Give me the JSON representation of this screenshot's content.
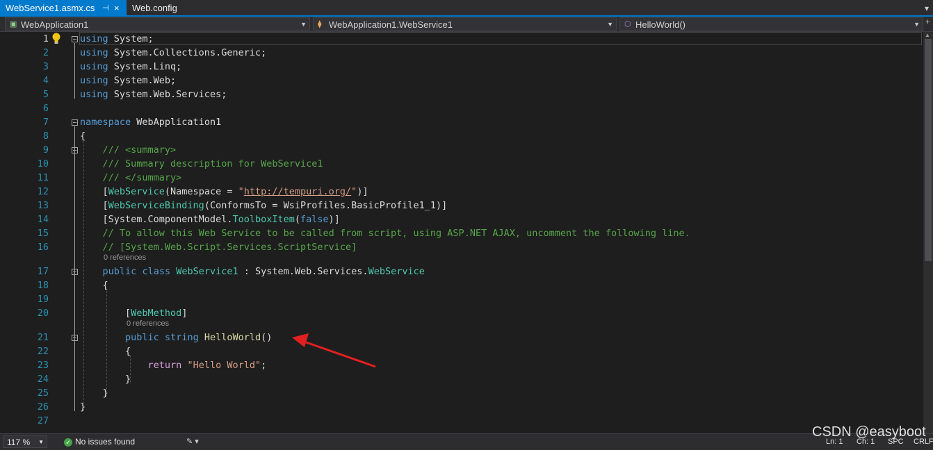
{
  "tabs": [
    {
      "label": "WebService1.asmx.cs",
      "active": true,
      "pin": "⊣",
      "close": "×"
    },
    {
      "label": "Web.config",
      "active": false
    }
  ],
  "tab_overflow": "▾",
  "nav": {
    "project": "WebApplication1",
    "class": "WebApplication1.WebService1",
    "member": "HelloWorld()"
  },
  "code": {
    "lines": [
      {
        "n": "1",
        "segs": [
          [
            "kw",
            "using"
          ],
          [
            "p",
            " System;"
          ]
        ]
      },
      {
        "n": "2",
        "segs": [
          [
            "kw",
            "using"
          ],
          [
            "p",
            " System.Collections.Generic;"
          ]
        ]
      },
      {
        "n": "3",
        "segs": [
          [
            "kw",
            "using"
          ],
          [
            "p",
            " System.Linq;"
          ]
        ]
      },
      {
        "n": "4",
        "segs": [
          [
            "kw",
            "using"
          ],
          [
            "p",
            " System.Web;"
          ]
        ]
      },
      {
        "n": "5",
        "segs": [
          [
            "kw",
            "using"
          ],
          [
            "p",
            " System.Web.Services;"
          ]
        ]
      },
      {
        "n": "6",
        "segs": []
      },
      {
        "n": "7",
        "segs": [
          [
            "kw",
            "namespace"
          ],
          [
            "p",
            " WebApplication1"
          ]
        ]
      },
      {
        "n": "8",
        "segs": [
          [
            "p",
            "{"
          ]
        ]
      },
      {
        "n": "9",
        "segs": [
          [
            "p",
            "    "
          ],
          [
            "cm",
            "/// <summary>"
          ]
        ]
      },
      {
        "n": "10",
        "segs": [
          [
            "p",
            "    "
          ],
          [
            "cm",
            "/// Summary description for WebService1"
          ]
        ]
      },
      {
        "n": "11",
        "segs": [
          [
            "p",
            "    "
          ],
          [
            "cm",
            "/// </summary>"
          ]
        ]
      },
      {
        "n": "12",
        "segs": [
          [
            "p",
            "    ["
          ],
          [
            "ty",
            "WebService"
          ],
          [
            "p",
            "(Namespace = "
          ],
          [
            "st",
            "\""
          ],
          [
            "ln2",
            "http://tempuri.org/"
          ],
          [
            "st",
            "\""
          ],
          [
            "p",
            ")]"
          ]
        ]
      },
      {
        "n": "13",
        "segs": [
          [
            "p",
            "    ["
          ],
          [
            "ty",
            "WebServiceBinding"
          ],
          [
            "p",
            "(ConformsTo = WsiProfiles.BasicProfile1_1)]"
          ]
        ]
      },
      {
        "n": "14",
        "segs": [
          [
            "p",
            "    [System.ComponentModel."
          ],
          [
            "ty",
            "ToolboxItem"
          ],
          [
            "p",
            "("
          ],
          [
            "kw",
            "false"
          ],
          [
            "p",
            ")]"
          ]
        ]
      },
      {
        "n": "15",
        "segs": [
          [
            "p",
            "    "
          ],
          [
            "cm",
            "// To allow this Web Service to be called from script, using ASP.NET AJAX, uncomment the following line."
          ]
        ]
      },
      {
        "n": "16",
        "segs": [
          [
            "p",
            "    "
          ],
          [
            "cm",
            "// [System.Web.Script.Services.ScriptService]"
          ]
        ]
      },
      {
        "n": "17",
        "segs": [
          [
            "p",
            "    "
          ],
          [
            "kw",
            "public"
          ],
          [
            "p",
            " "
          ],
          [
            "kw",
            "class"
          ],
          [
            "p",
            " "
          ],
          [
            "ty",
            "WebService1"
          ],
          [
            "p",
            " : System.Web.Services."
          ],
          [
            "ty",
            "WebService"
          ]
        ]
      },
      {
        "n": "18",
        "segs": [
          [
            "p",
            "    {"
          ]
        ]
      },
      {
        "n": "19",
        "segs": []
      },
      {
        "n": "20",
        "segs": [
          [
            "p",
            "        ["
          ],
          [
            "ty",
            "WebMethod"
          ],
          [
            "p",
            "]"
          ]
        ]
      },
      {
        "n": "21",
        "segs": [
          [
            "p",
            "        "
          ],
          [
            "kw",
            "public"
          ],
          [
            "p",
            " "
          ],
          [
            "kw",
            "string"
          ],
          [
            "p",
            " "
          ],
          [
            "mt",
            "HelloWorld"
          ],
          [
            "p",
            "()"
          ]
        ]
      },
      {
        "n": "22",
        "segs": [
          [
            "p",
            "        {"
          ]
        ]
      },
      {
        "n": "23",
        "segs": [
          [
            "p",
            "            "
          ],
          [
            "ck",
            "return"
          ],
          [
            "p",
            " "
          ],
          [
            "st",
            "\"Hello World\""
          ],
          [
            "p",
            ";"
          ]
        ]
      },
      {
        "n": "24",
        "segs": [
          [
            "p",
            "        }"
          ]
        ]
      },
      {
        "n": "25",
        "segs": [
          [
            "p",
            "    }"
          ]
        ]
      },
      {
        "n": "26",
        "segs": [
          [
            "p",
            "}"
          ]
        ]
      },
      {
        "n": "27",
        "segs": []
      }
    ],
    "codelens": {
      "class": "0 references",
      "method": "0 references"
    }
  },
  "status": {
    "zoom": "117 %",
    "issues": "No issues found",
    "ln": "Ln: 1",
    "ch": "Ch: 1",
    "spc": "SPC",
    "crlf": "CRLF"
  },
  "watermark": "CSDN @easyboot",
  "colors": {
    "accent": "#007acc",
    "keyword": "#569cd6",
    "type": "#4ec9b0",
    "comment": "#57a64a",
    "string": "#d69d85",
    "annotation_arrow": "#e02020"
  },
  "icons": [
    "pin-icon",
    "close-icon",
    "project-icon",
    "class-icon",
    "method-icon",
    "lightbulb-icon",
    "issues-ok-icon",
    "brush-icon"
  ]
}
